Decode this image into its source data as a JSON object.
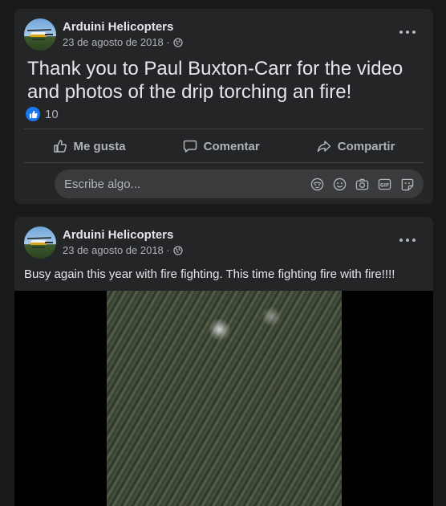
{
  "posts": [
    {
      "author": "Arduini Helicopters",
      "date": "23 de agosto de 2018 ·",
      "text": "Thank you to Paul Buxton-Carr for the video and photos of the drip torching an fire!",
      "reaction_count": "10",
      "actions": {
        "like": "Me gusta",
        "comment": "Comentar",
        "share": "Compartir"
      },
      "comment_placeholder": "Escribe algo..."
    },
    {
      "author": "Arduini Helicopters",
      "date": "23 de agosto de 2018 ·",
      "text": "Busy again this year with fire fighting. This time fighting fire with fire!!!!"
    }
  ],
  "icons": {
    "privacy": "globe-icon",
    "more": "more-options-icon",
    "like": "thumbs-up-icon",
    "comment": "speech-bubble-icon",
    "share": "share-arrow-icon",
    "comment_tools": [
      "avatar-sticker-icon",
      "emoji-icon",
      "camera-icon",
      "gif-icon",
      "sticker-icon"
    ]
  },
  "colors": {
    "background": "#18191a",
    "card": "#242526",
    "accent": "#1877f2",
    "text": "#e4e6eb",
    "muted": "#b0b3b8"
  }
}
